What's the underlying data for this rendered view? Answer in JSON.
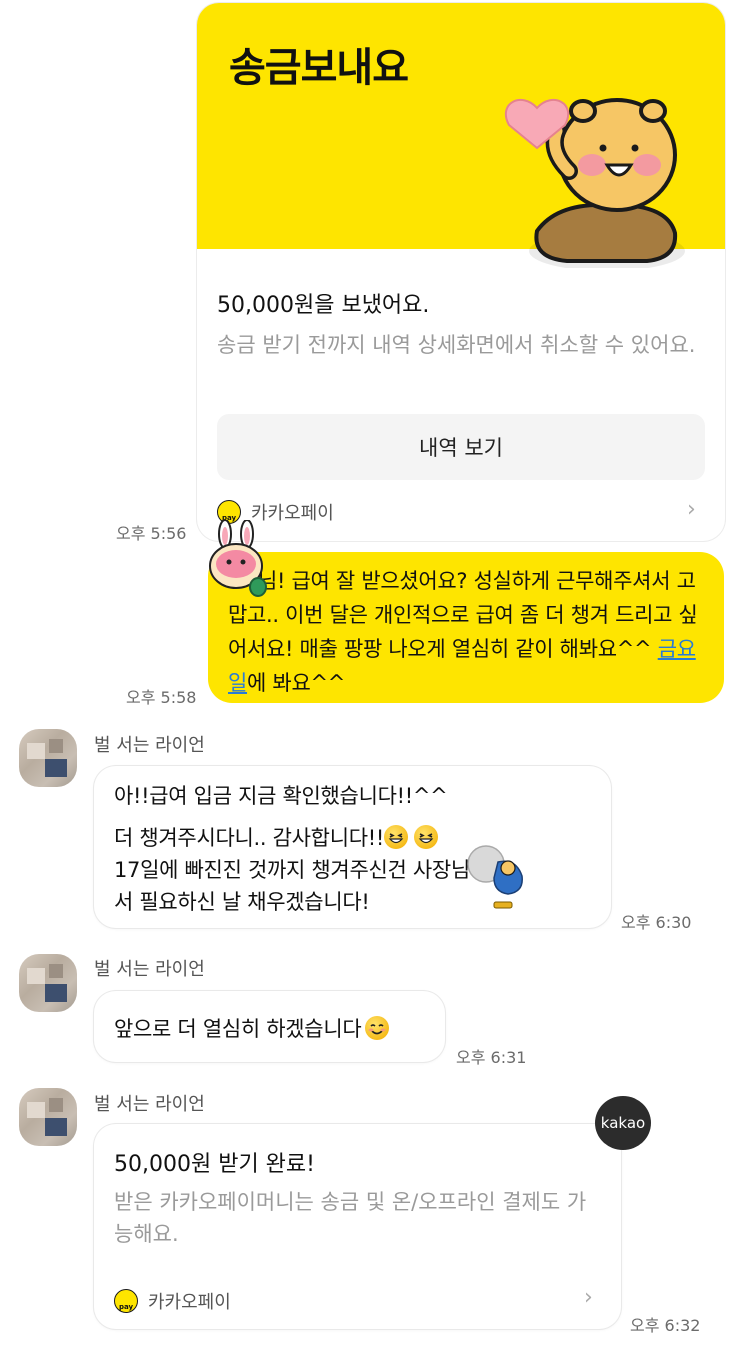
{
  "send_card": {
    "title": "송금보내요",
    "amount_text": "50,000원을 보냈어요.",
    "description": "송금 받기 전까지 내역 상세화면에서 취소할 수 있어요.",
    "history_button": "내역 보기",
    "service_label": "카카오페이",
    "badge_text": "pay",
    "chevron": "›",
    "time": "오후 5:56"
  },
  "my_message": {
    "text_before_link": "님! 급여 잘 받으셨어요? 성실하게 근무해주셔서 고맙고.. 이번 달은 개인적으로 급여 좀 더 챙겨 드리고 싶어서요! 매출 팡팡 나오게 열심히 같이 해봐요^^ ",
    "link_text": "금요일",
    "text_after_link": "에 봐요^^",
    "time": "오후 5:58"
  },
  "sender_name": "벌 서는 라이언",
  "reply_1": {
    "lines": [
      "아!!급여 입금 지금 확인했습니다!!^^",
      "더 챙겨주시다니.. 감사합니다!!",
      "17일에 빠진진 것까지 챙겨주신건 사장님께",
      "서 필요하신 날 채우겠습니다!"
    ],
    "time": "오후 6:30"
  },
  "reply_2": {
    "text": "앞으로 더 열심히 하겠습니다",
    "time": "오후 6:31"
  },
  "receive_card": {
    "amount_text": "50,000원 받기 완료!",
    "description": "받은 카카오페이머니는 송금 및 온/오프라인 결제도 가능해요.",
    "service_label": "카카오페이",
    "badge_text": "pay",
    "chevron": "›",
    "time": "오후 6:32"
  },
  "kakao_badge": "kakao",
  "colors": {
    "kakao_yellow": "#fee500",
    "link_blue": "#2a7bd6",
    "background": "#ffffff"
  },
  "icons": [
    "ryan-character-illustration",
    "apeach-emoticon",
    "grin-emoji",
    "smile-emoji",
    "sticker-figure",
    "pay-icon",
    "chevron-right-icon"
  ]
}
